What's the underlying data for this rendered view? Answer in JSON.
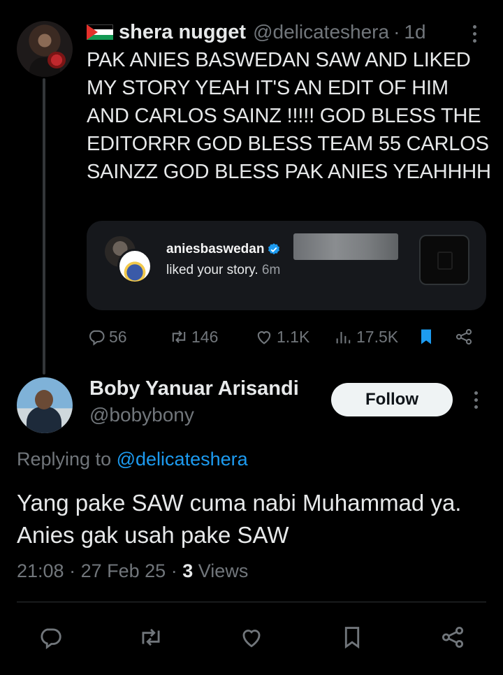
{
  "parent_tweet": {
    "display_name": "shera nugget",
    "handle": "@delicateshera",
    "separator": "·",
    "time_ago": "1d",
    "text": "PAK ANIES BASWEDAN SAW AND LIKED MY STORY YEAH IT'S AN EDIT OF HIM AND CARLOS SAINZ !!!!! GOD BLESS THE EDITORRR GOD BLESS TEAM 55 CARLOS SAINZZ GOD BLESS PAK ANIES YEAHHHH",
    "flag_icon": "palestine-flag-icon",
    "embedded_card": {
      "username": "aniesbaswedan",
      "message": "liked your story.",
      "time_ago": "6m"
    },
    "stats": {
      "replies": "56",
      "reposts": "146",
      "likes": "1.1K",
      "views": "17.5K"
    },
    "bookmark_color": "#1d9bf0"
  },
  "reply_tweet": {
    "display_name": "Boby Yanuar Arisandi",
    "handle": "@bobybony",
    "follow_label": "Follow",
    "replying_prefix": "Replying to",
    "replying_mention": "@delicateshera",
    "text": "Yang pake SAW cuma nabi Muhammad ya. Anies gak usah pake SAW",
    "time": "21:08",
    "date": "27 Feb 25",
    "separator": "·",
    "views_count": "3",
    "views_label": "Views"
  },
  "colors": {
    "background": "#000000",
    "text": "#e7e9ea",
    "muted": "#71767b",
    "link": "#1d9bf0"
  }
}
